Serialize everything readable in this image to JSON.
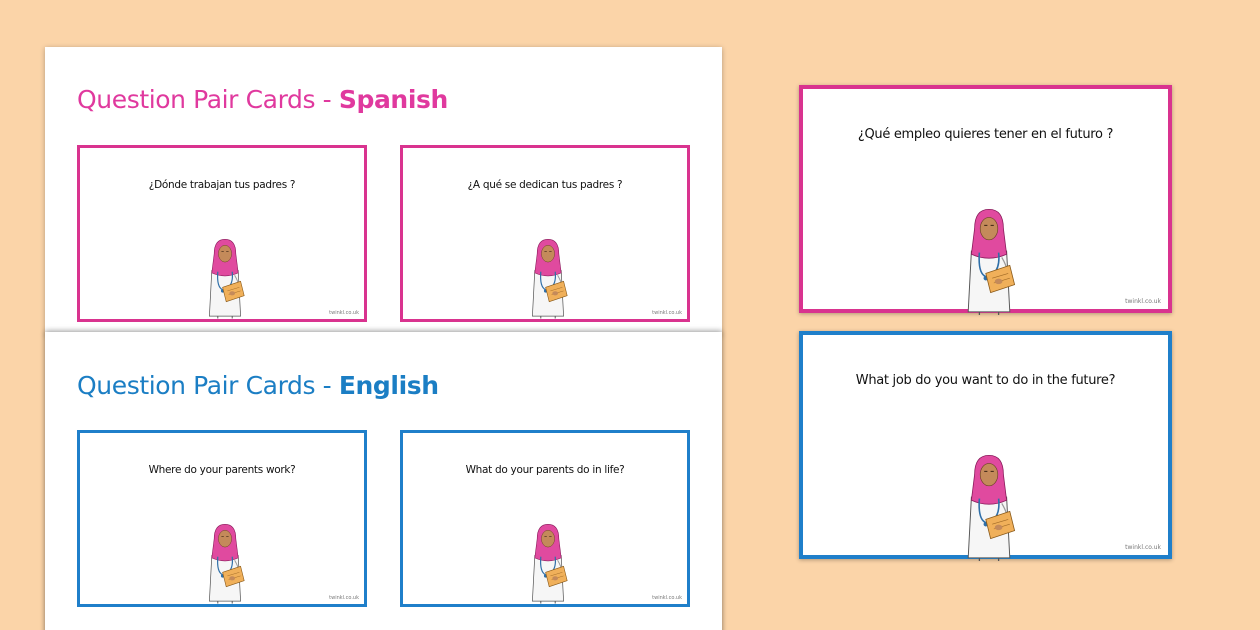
{
  "sheets": {
    "spanish": {
      "title_prefix": "Question Pair Cards - ",
      "title_lang": "Spanish",
      "cards": [
        {
          "question": "¿Dónde trabajan tus padres ?",
          "logo": "twinkl.co.uk"
        },
        {
          "question": "¿A qué se dedican tus padres ?",
          "logo": "twinkl.co.uk"
        }
      ]
    },
    "english": {
      "title_prefix": "Question Pair Cards - ",
      "title_lang": "English",
      "cards": [
        {
          "question": "Where do your parents work?",
          "logo": "twinkl.co.uk"
        },
        {
          "question": "What do your parents do in life?",
          "logo": "twinkl.co.uk"
        }
      ]
    }
  },
  "featured_cards": [
    {
      "question": "¿Qué empleo quieres tener en el futuro ?",
      "logo": "twinkl.co.uk"
    },
    {
      "question": "What job do you want to do in the future?",
      "logo": "twinkl.co.uk"
    }
  ],
  "colors": {
    "background": "#fbd4a8",
    "spanish_accent": "#d9338f",
    "english_accent": "#1f7fca"
  },
  "illustration": "doctor-with-clipboard-icon"
}
